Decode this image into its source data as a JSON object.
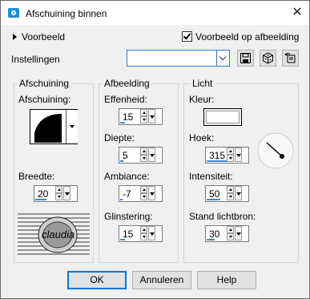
{
  "window": {
    "title": "Afschuining binnen",
    "close": "✕"
  },
  "preview": {
    "label": "Voorbeeld",
    "show_on_image_label": "Voorbeeld op afbeelding",
    "show_on_image_checked": true
  },
  "settings": {
    "label": "Instellingen",
    "value": ""
  },
  "bevel": {
    "group_label": "Afschuining",
    "shape_label": "Afschuining:",
    "width_label": "Breedte:",
    "width_value": "20"
  },
  "image": {
    "group_label": "Afbeelding",
    "smoothness_label": "Effenheid:",
    "smoothness_value": "15",
    "depth_label": "Diepte:",
    "depth_value": "5",
    "ambience_label": "Ambiance:",
    "ambience_value": "-7",
    "shininess_label": "Glinstering:",
    "shininess_value": "15"
  },
  "light": {
    "group_label": "Licht",
    "color_label": "Kleur:",
    "color_value": "#ffffff",
    "angle_label": "Hoek:",
    "angle_value": "315",
    "intensity_label": "Intensiteit:",
    "intensity_value": "50",
    "elevation_label": "Stand lichtbron:",
    "elevation_value": "30"
  },
  "watermark": {
    "text": "claudia"
  },
  "buttons": {
    "ok": "OK",
    "cancel": "Annuleren",
    "help": "Help"
  }
}
